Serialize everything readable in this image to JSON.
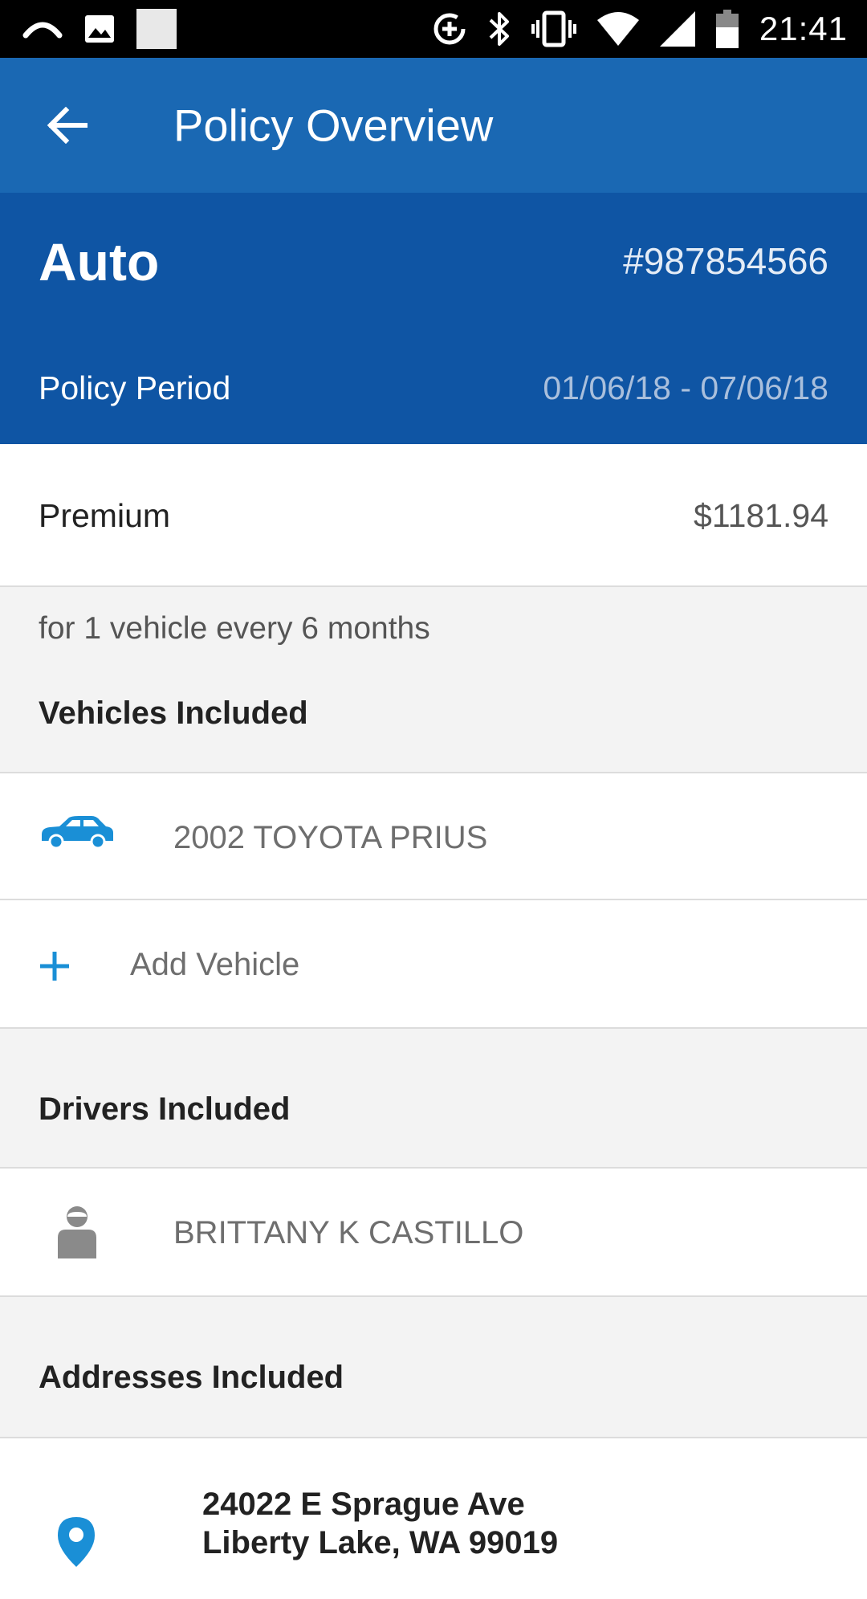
{
  "status_bar": {
    "time": "21:41",
    "icons": [
      "swipe-icon",
      "image-icon",
      "square-icon",
      "data-saver-icon",
      "bluetooth-icon",
      "vibrate-icon",
      "wifi-icon",
      "signal-icon",
      "battery-icon"
    ]
  },
  "app_bar": {
    "title": "Policy Overview",
    "back_icon": "arrow-left-icon",
    "background": "#1a68b3"
  },
  "policy": {
    "type": "Auto",
    "number": "#987854566",
    "period_label": "Policy Period",
    "period_value": "01/06/18 - 07/06/18",
    "background": "#0f55a4"
  },
  "premium": {
    "label": "Premium",
    "value": "$1181.94",
    "note": "for 1 vehicle every 6 months"
  },
  "vehicles": {
    "heading": "Vehicles Included",
    "items": [
      {
        "name": "2002 TOYOTA PRIUS",
        "icon": "car-icon"
      }
    ],
    "add_label": "Add Vehicle",
    "add_icon": "plus-icon"
  },
  "drivers": {
    "heading": "Drivers Included",
    "items": [
      {
        "name": "BRITTANY K CASTILLO",
        "icon": "person-icon"
      }
    ]
  },
  "addresses": {
    "heading": "Addresses Included",
    "items": [
      {
        "line1": "24022 E Sprague Ave",
        "line2": "Liberty Lake, WA 99019",
        "icon": "location-pin-icon"
      }
    ]
  },
  "accent_color": "#1a8fd6"
}
